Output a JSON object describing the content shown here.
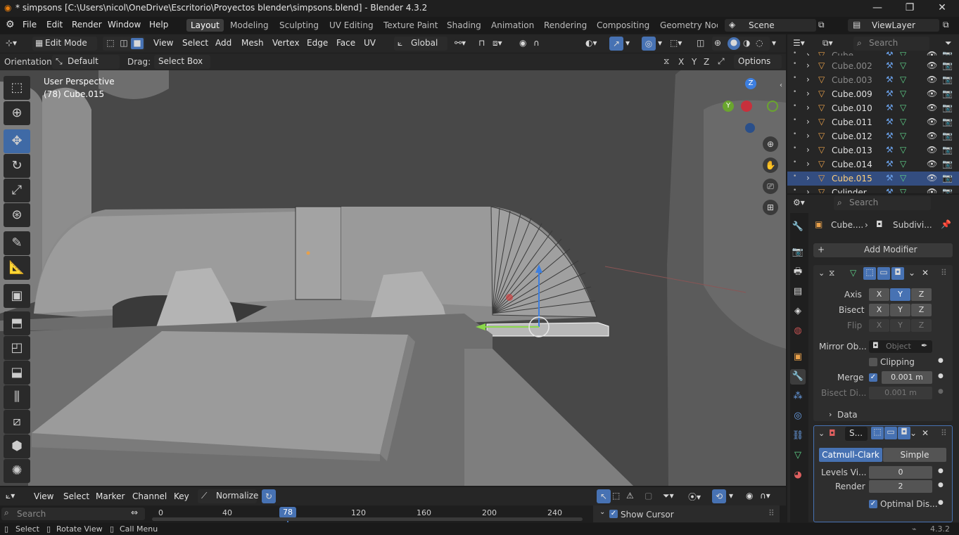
{
  "window": {
    "title": "* simpsons [C:\\Users\\nicol\\OneDrive\\Escritorio\\Proyectos blender\\simpsons.blend] - Blender 4.3.2",
    "min": "—",
    "max": "❐",
    "close": "✕"
  },
  "menu": [
    "File",
    "Edit",
    "Render",
    "Window",
    "Help"
  ],
  "workspaces": [
    "Layout",
    "Modeling",
    "Sculpting",
    "UV Editing",
    "Texture Paint",
    "Shading",
    "Animation",
    "Rendering",
    "Compositing",
    "Geometry Node"
  ],
  "active_workspace": "Layout",
  "scene": "Scene",
  "view_layer": "ViewLayer",
  "viewport_header": {
    "mode": "Edit Mode",
    "menus": [
      "View",
      "Select",
      "Add",
      "Mesh",
      "Vertex",
      "Edge",
      "Face",
      "UV"
    ],
    "transform_orientation": "Global"
  },
  "tool_settings": {
    "orientation_label": "Orientation:",
    "orientation": "Default",
    "drag_label": "Drag:",
    "drag": "Select Box",
    "axes": [
      "X",
      "Y",
      "Z"
    ],
    "options": "Options"
  },
  "viewport": {
    "view_name": "User Perspective",
    "object_info": "(78) Cube.015"
  },
  "gizmo": {
    "z": "Z",
    "y": "Y"
  },
  "outliner": {
    "search_placeholder": "Search",
    "items": [
      {
        "name": "Cube",
        "dim": true
      },
      {
        "name": "Cube.002",
        "dim": true
      },
      {
        "name": "Cube.003",
        "dim": true
      },
      {
        "name": "Cube.009",
        "dim": false
      },
      {
        "name": "Cube.010",
        "dim": false
      },
      {
        "name": "Cube.011",
        "dim": false
      },
      {
        "name": "Cube.012",
        "dim": false
      },
      {
        "name": "Cube.013",
        "dim": false
      },
      {
        "name": "Cube.014",
        "dim": false
      },
      {
        "name": "Cube.015",
        "dim": false,
        "selected": true
      },
      {
        "name": "Cylinder",
        "dim": false
      }
    ]
  },
  "properties": {
    "search_placeholder": "Search",
    "breadcrumb_object": "Cube....",
    "breadcrumb_modifier": "Subdivi...",
    "add_modifier": "Add Modifier",
    "mirror": {
      "axis_label": "Axis",
      "bisect_label": "Bisect",
      "flip_label": "Flip",
      "axes": [
        "X",
        "Y",
        "Z"
      ],
      "axis_active": "Y",
      "mirror_object_label": "Mirror Ob...",
      "mirror_object_placeholder": "Object",
      "clipping_label": "Clipping",
      "merge_label": "Merge",
      "merge_value": "0.001 m",
      "bisect_distance_label": "Bisect Di...",
      "bisect_distance_value": "0.001 m",
      "data_label": "Data"
    },
    "subdivision": {
      "name": "S...",
      "catmull_clark": "Catmull-Clark",
      "simple": "Simple",
      "levels_viewport_label": "Levels Vi...",
      "levels_viewport": "0",
      "render_label": "Render",
      "render_value": "2",
      "optimal_display_label": "Optimal Dis..."
    }
  },
  "timeline": {
    "menus": [
      "View",
      "Select",
      "Marker",
      "Channel",
      "Key"
    ],
    "normalize": "Normalize",
    "search_placeholder": "Search",
    "current_frame": "78",
    "ticks": [
      "0",
      "40",
      "120",
      "160",
      "200",
      "240"
    ],
    "show_cursor": "Show Cursor"
  },
  "status_bar": {
    "select": "Select",
    "rotate": "Rotate View",
    "menu": "Call Menu",
    "version": "4.3.2"
  },
  "colors": {
    "accent": "#4772b3",
    "active_orange": "#e8a04a",
    "mesh_green": "#5fd38a"
  }
}
